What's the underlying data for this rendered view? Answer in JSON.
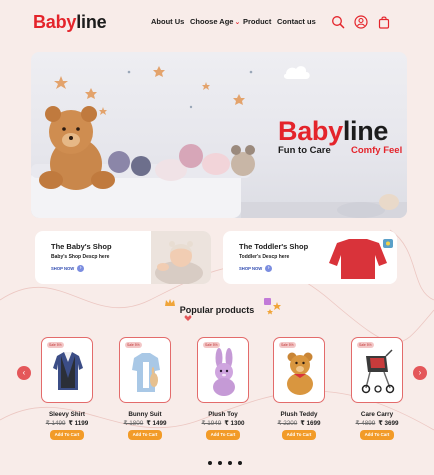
{
  "header": {
    "logo_part1": "Baby",
    "logo_part2": "line",
    "nav": [
      "About Us",
      "Choose Age",
      "Product",
      "Contact us"
    ],
    "icons": [
      "search-icon",
      "user-icon",
      "shopping-bag-icon"
    ]
  },
  "hero": {
    "brand_part1": "Baby",
    "brand_part2": "line",
    "tagline_1": "Fun to Care",
    "tagline_2": "Comfy Feel"
  },
  "shops": [
    {
      "title": "The Baby's Shop",
      "description": "Baby's Shop Descp here",
      "cta": "SHOP NOW"
    },
    {
      "title": "The Toddler's Shop",
      "description": "Toddler's Descp here",
      "cta": "SHOP NOW"
    }
  ],
  "popular": {
    "heading": "Popular products",
    "badge": "Sale 5%",
    "button_label": "Add To Cart",
    "products": [
      {
        "name": "Sleevy Shirt",
        "old_price": "₹ 1499",
        "new_price": "₹ 1199",
        "icon": "shirt-vest-icon"
      },
      {
        "name": "Bunny Suit",
        "old_price": "₹ 1800",
        "new_price": "₹ 1499",
        "icon": "bunny-suit-icon"
      },
      {
        "name": "Plush Toy",
        "old_price": "₹ 1949",
        "new_price": "₹ 1300",
        "icon": "plush-bunny-icon"
      },
      {
        "name": "Plush Teddy",
        "old_price": "₹ 2200",
        "new_price": "₹ 1699",
        "icon": "teddy-bear-icon"
      },
      {
        "name": "Care  Carry",
        "old_price": "₹ 4899",
        "new_price": "₹ 3699",
        "icon": "stroller-icon"
      }
    ]
  },
  "carousel": {
    "prev_icon": "chevron-left-icon",
    "next_icon": "chevron-right-icon",
    "dots": 4
  },
  "colors": {
    "brand_red": "#e4242b",
    "button_orange": "#f29b28",
    "background": "#f8ece9"
  }
}
